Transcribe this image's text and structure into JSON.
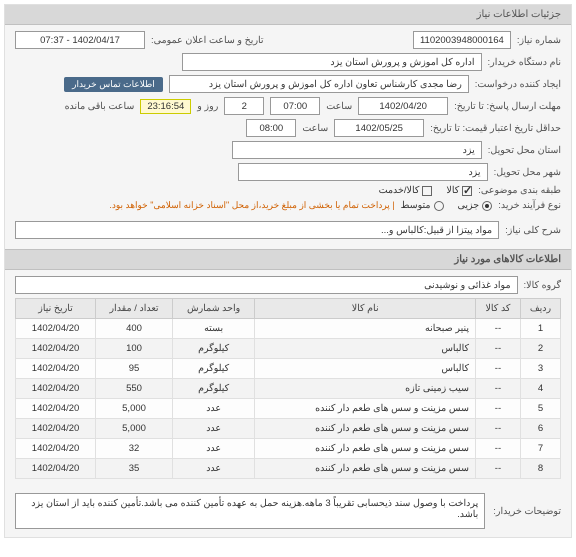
{
  "headers": {
    "main": "جزئیات اطلاعات نیاز",
    "items": "اطلاعات کالاهای مورد نیاز"
  },
  "labels": {
    "need_no": "شماره نیاز:",
    "announce_dt": "تاریخ و ساعت اعلان عمومی:",
    "buyer_org": "نام دستگاه خریدار:",
    "requester": "ایجاد کننده درخواست:",
    "contact": "اطلاعات تماس خریدار",
    "deadline": "مهلت ارسال پاسخ: تا تاریخ:",
    "time": "ساعت",
    "day_and": "روز و",
    "remain": "ساعت باقی مانده",
    "valid_min": "حداقل تاریخ اعتبار قیمت: تا تاریخ:",
    "province": "استان محل تحویل:",
    "city": "شهر محل تحویل:",
    "subject_cat": "طبقه بندی موضوعی:",
    "good": "کالا",
    "service": "کالا/خدمت",
    "purchase_type": "نوع فرآیند خرید:",
    "minor": "جزیی",
    "medium": "متوسط",
    "payment_note": "| پرداخت تمام یا بخشی از مبلغ خرید،از محل \"اسناد خزانه اسلامی\" خواهد بود.",
    "overview": "شرح کلی نیاز:",
    "group": "گروه کالا:",
    "buyer_notes": "توضیحات خریدار:"
  },
  "values": {
    "need_no": "1102003948000164",
    "announce_dt": "1402/04/17 - 07:37",
    "buyer_org": "اداره کل اموزش و پرورش استان یزد",
    "requester": "رضا مجدی کارشناس تعاون اداره کل اموزش و پرورش استان یزد",
    "deadline_date": "1402/04/20",
    "deadline_time": "07:00",
    "days_remain": "2",
    "countdown": "23:16:54",
    "valid_date": "1402/05/25",
    "valid_time": "08:00",
    "province": "یزد",
    "city": "یزد",
    "good_checked": true,
    "service_checked": false,
    "purchase_selected": "minor",
    "overview": "مواد پیتزا از قبیل:کالباس و...",
    "group": "مواد غذائی و نوشیدنی",
    "description": "پرداخت با وصول سند ذیحسابی تقریباً 3 ماهه.هزینه حمل به عهده تأمین کننده می باشد.تأمین کننده باید از استان یزد باشد."
  },
  "table": {
    "columns": [
      "ردیف",
      "کد کالا",
      "نام کالا",
      "واحد شمارش",
      "تعداد / مقدار",
      "تاریخ نیاز"
    ],
    "rows": [
      {
        "n": "1",
        "code": "--",
        "name": "پنیر صبحانه",
        "unit": "بسته",
        "qty": "400",
        "date": "1402/04/20"
      },
      {
        "n": "2",
        "code": "--",
        "name": "کالباس",
        "unit": "کیلوگرم",
        "qty": "100",
        "date": "1402/04/20"
      },
      {
        "n": "3",
        "code": "--",
        "name": "کالباس",
        "unit": "کیلوگرم",
        "qty": "95",
        "date": "1402/04/20"
      },
      {
        "n": "4",
        "code": "--",
        "name": "سیب زمینی تازه",
        "unit": "کیلوگرم",
        "qty": "550",
        "date": "1402/04/20"
      },
      {
        "n": "5",
        "code": "--",
        "name": "سس مزینت و سس های طعم دار کننده",
        "unit": "عدد",
        "qty": "5,000",
        "date": "1402/04/20"
      },
      {
        "n": "6",
        "code": "--",
        "name": "سس مزینت و سس های طعم دار کننده",
        "unit": "عدد",
        "qty": "5,000",
        "date": "1402/04/20"
      },
      {
        "n": "7",
        "code": "--",
        "name": "سس مزینت و سس های طعم دار کننده",
        "unit": "عدد",
        "qty": "32",
        "date": "1402/04/20"
      },
      {
        "n": "8",
        "code": "--",
        "name": "سس مزینت و سس های طعم دار کننده",
        "unit": "عدد",
        "qty": "35",
        "date": "1402/04/20"
      }
    ]
  }
}
